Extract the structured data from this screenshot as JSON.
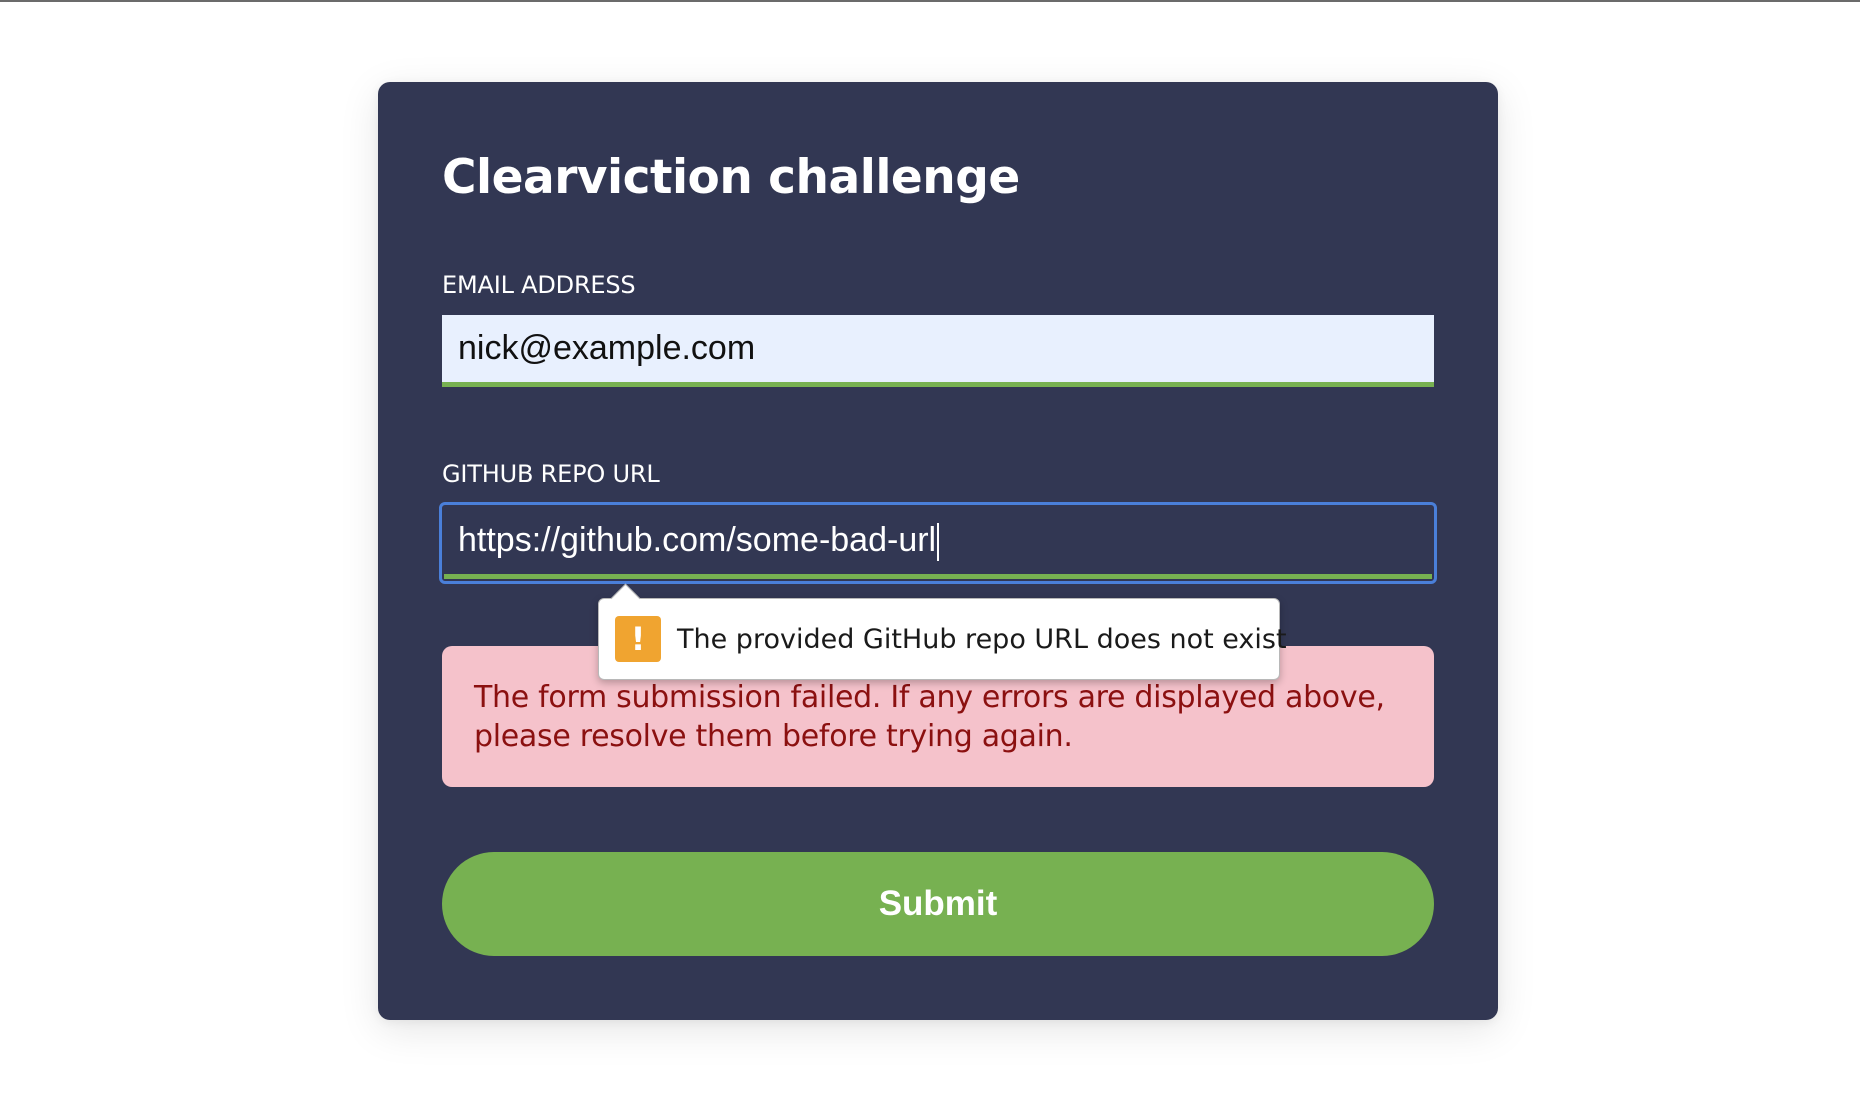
{
  "form": {
    "title": "Clearviction challenge",
    "email": {
      "label": "EMAIL ADDRESS",
      "value": "nick@example.com"
    },
    "repo": {
      "label": "GITHUB REPO URL",
      "value": "https://github.com/some-bad-url"
    },
    "error_message": "The form submission failed. If any errors are displayed above, please resolve them before trying again.",
    "submit_label": "Submit"
  },
  "validation_tooltip": {
    "icon": "warning-icon",
    "icon_glyph": "!",
    "message": "The provided GitHub repo URL does not exist"
  },
  "colors": {
    "card_background": "#323753",
    "accent_green": "#77b151",
    "error_background": "#f5c2cb",
    "error_text": "#8b1010",
    "focus_ring": "#4a7fd9",
    "warning": "#f0a430"
  }
}
